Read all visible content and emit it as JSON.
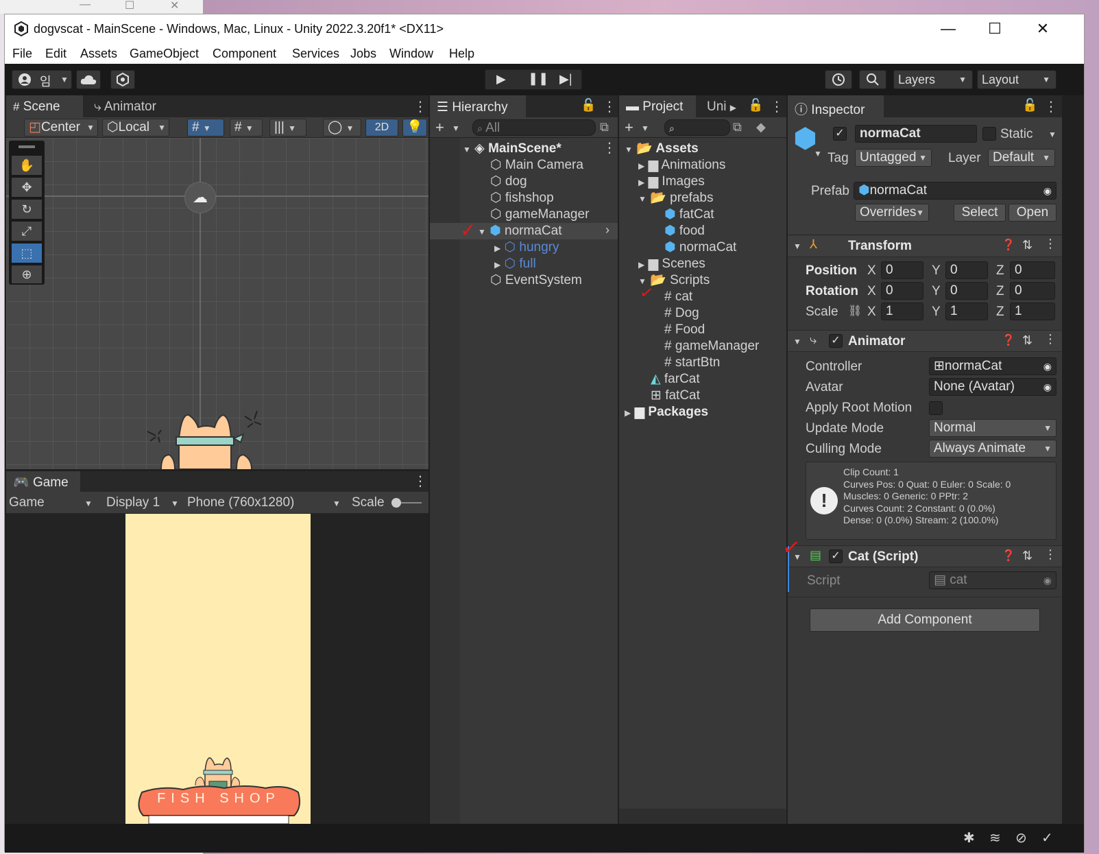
{
  "window": {
    "title": "dogvscat - MainScene - Windows, Mac, Linux - Unity 2022.3.20f1* <DX11>"
  },
  "menu": [
    "File",
    "Edit",
    "Assets",
    "GameObject",
    "Component",
    "Services",
    "Jobs",
    "Window",
    "Help"
  ],
  "toolbar": {
    "account": "임",
    "layers": "Layers",
    "layout": "Layout"
  },
  "scene": {
    "tab_scene": "Scene",
    "tab_animator": "Animator",
    "pivot": "Center",
    "space": "Local",
    "mode2d": "2D"
  },
  "game": {
    "tab": "Game",
    "view": "Game",
    "display": "Display 1",
    "resolution": "Phone (760x1280)",
    "scale": "Scale",
    "sign": "FISH SHOP"
  },
  "hierarchy": {
    "tab": "Hierarchy",
    "search_placeholder": "All",
    "scene_name": "MainScene*",
    "items": [
      "Main Camera",
      "dog",
      "fishshop",
      "gameManager",
      "normaCat",
      "hungry",
      "full",
      "EventSystem"
    ]
  },
  "project": {
    "tab": "Project",
    "tab2": "Uni",
    "root": "Assets",
    "items": [
      "Animations",
      "Images",
      "prefabs",
      "fatCat",
      "food",
      "normaCat",
      "Scenes",
      "Scripts",
      "cat",
      "Dog",
      "Food",
      "gameManager",
      "startBtn",
      "farCat",
      "fatCat",
      "Packages"
    ]
  },
  "inspector": {
    "tab": "Inspector",
    "object_name": "normaCat",
    "static_label": "Static",
    "tag_label": "Tag",
    "tag_value": "Untagged",
    "layer_label": "Layer",
    "layer_value": "Default",
    "prefab_label": "Prefab",
    "prefab_value": "normaCat",
    "overrides": "Overrides",
    "select": "Select",
    "open": "Open",
    "transform": {
      "title": "Transform",
      "position_label": "Position",
      "rotation_label": "Rotation",
      "scale_label": "Scale",
      "x": "X",
      "y": "Y",
      "z": "Z",
      "pos": [
        "0",
        "0",
        "0"
      ],
      "rot": [
        "0",
        "0",
        "0"
      ],
      "scl": [
        "1",
        "1",
        "1"
      ]
    },
    "animator": {
      "title": "Animator",
      "controller_label": "Controller",
      "controller_value": "normaCat",
      "avatar_label": "Avatar",
      "avatar_value": "None (Avatar)",
      "root_motion_label": "Apply Root Motion",
      "update_label": "Update Mode",
      "update_value": "Normal",
      "culling_label": "Culling Mode",
      "culling_value": "Always Animate",
      "info": [
        "Clip Count: 1",
        "Curves Pos: 0 Quat: 0 Euler: 0 Scale: 0",
        "Muscles: 0 Generic: 0 PPtr: 2",
        "Curves Count: 2 Constant: 0 (0.0%)",
        "Dense: 0 (0.0%) Stream: 2 (100.0%)"
      ]
    },
    "cat_script": {
      "title": "Cat (Script)",
      "script_label": "Script",
      "script_value": "cat"
    },
    "add_component": "Add Component"
  },
  "colors": {
    "accent": "#3a72b0",
    "panel": "#383838",
    "prefab_blue": "#58b4f0",
    "mark_red": "#e21818"
  }
}
